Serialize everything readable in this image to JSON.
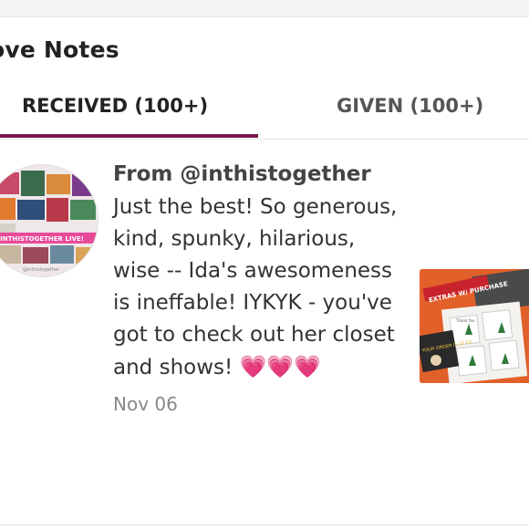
{
  "header": {
    "title": "ove Notes"
  },
  "tabs": [
    {
      "label": "RECEIVED (100+)",
      "active": true
    },
    {
      "label": "GIVEN (100+)",
      "active": false
    }
  ],
  "note": {
    "from": "From @inthistogether",
    "body": "Just the best! So generous, kind, spunky, hilarious, wise -- Ida's awesomeness is ineffable! IYKYK - you've got to check out her closet and shows!",
    "hearts": "💗💗💗",
    "date": "Nov 06",
    "avatar_banner": "INTHISTOGETHER LIVE!",
    "avatar_caption": "@inthistogether"
  },
  "listing": {
    "banner_text": "EXTRAS W/ PURCHASE",
    "card_text": "Thank You",
    "corner_text": "YOUR ORDER IS AT EX"
  },
  "colors": {
    "accent": "#7b1a4e",
    "heart": "#e8438f",
    "thumb_bg": "#e2602a"
  }
}
